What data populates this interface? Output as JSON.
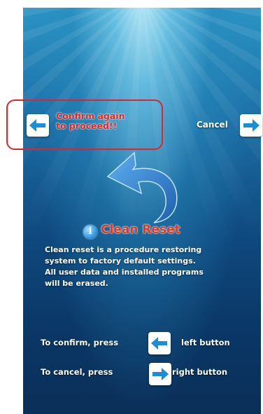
{
  "header": {
    "confirm_message_line1": "Confirm again",
    "confirm_message_line2": "to proceed!!",
    "cancel_label": "Cancel"
  },
  "dialog": {
    "title": "Clean Reset",
    "description_lines": [
      "Clean reset is a procedure restoring",
      "system to factory default settings.",
      "All user data and installed programs",
      "will be erased."
    ]
  },
  "instructions": {
    "confirm_prefix": "To confirm, press",
    "confirm_suffix": "left button",
    "cancel_prefix": "To cancel, press",
    "cancel_suffix": "right button"
  },
  "icons": {
    "left_arrow": "left-arrow-icon",
    "right_arrow": "right-arrow-icon",
    "undo": "undo-arrow-icon",
    "info": "info-icon"
  },
  "colors": {
    "warning_red": "#e0261f",
    "highlight_red": "#e0242c",
    "arrow_blue": "#1a8fd8",
    "background_blue": "#0f4a80"
  }
}
